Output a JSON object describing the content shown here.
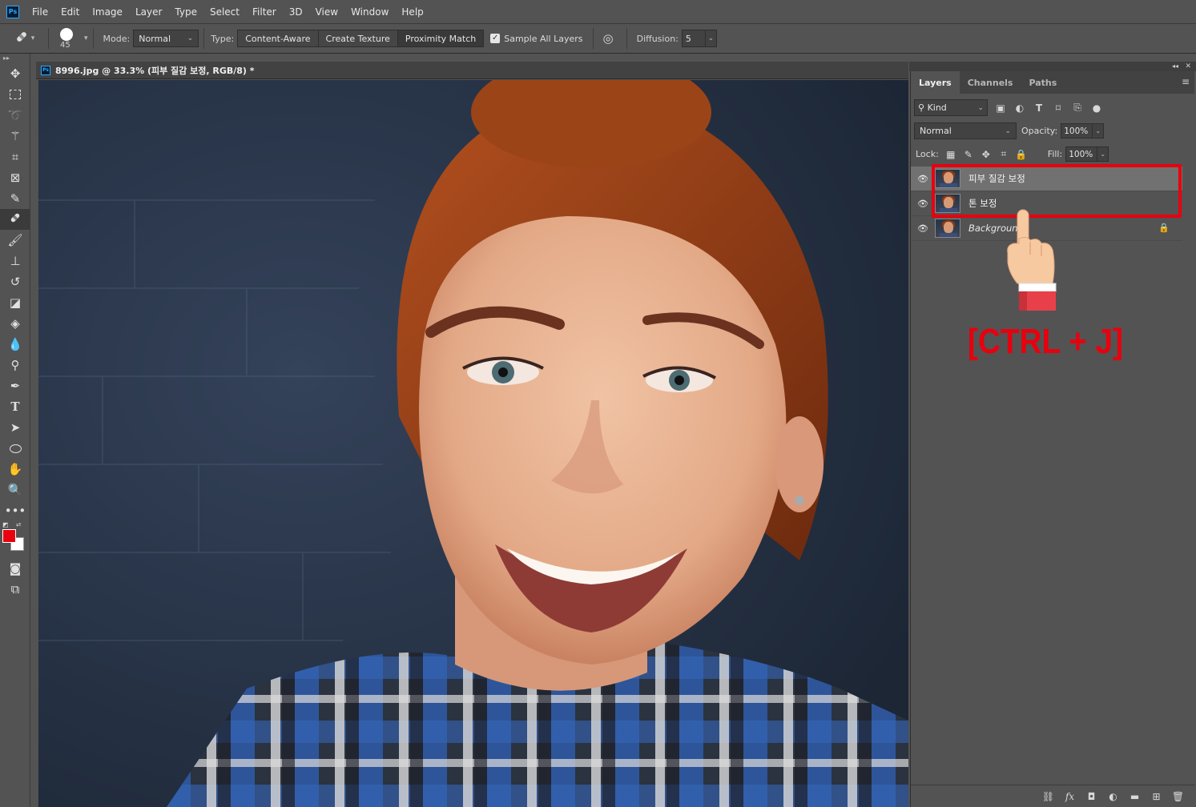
{
  "menu": {
    "logo": "Ps",
    "items": [
      "File",
      "Edit",
      "Image",
      "Layer",
      "Type",
      "Select",
      "Filter",
      "3D",
      "View",
      "Window",
      "Help"
    ]
  },
  "options": {
    "brush_size": "45",
    "mode_label": "Mode:",
    "mode_value": "Normal",
    "type_label": "Type:",
    "type_options": [
      "Content-Aware",
      "Create Texture",
      "Proximity Match"
    ],
    "type_selected": "Proximity Match",
    "sample_all_layers": "Sample All Layers",
    "sample_checked": true,
    "diffusion_label": "Diffusion:",
    "diffusion_value": "5"
  },
  "document": {
    "tab_title": "8996.jpg @ 33.3% (피부 질감 보정, RGB/8) *"
  },
  "panel": {
    "tabs": [
      "Layers",
      "Channels",
      "Paths"
    ],
    "active_tab": "Layers",
    "filter_kind": "Kind",
    "blend_mode": "Normal",
    "opacity_label": "Opacity:",
    "opacity_value": "100%",
    "lock_label": "Lock:",
    "fill_label": "Fill:",
    "fill_value": "100%",
    "layers": [
      {
        "name": "피부 질감 보정",
        "selected": true,
        "visible": true,
        "locked": false
      },
      {
        "name": "톤 보정",
        "selected": false,
        "visible": true,
        "locked": false
      },
      {
        "name": "Background",
        "selected": false,
        "visible": true,
        "locked": true
      }
    ]
  },
  "annotation": {
    "shortcut": "[CTRL + J]",
    "color": "#e8000e"
  },
  "colors": {
    "foreground": "#e8000e",
    "background": "#ffffff",
    "ui_bg": "#535353"
  }
}
